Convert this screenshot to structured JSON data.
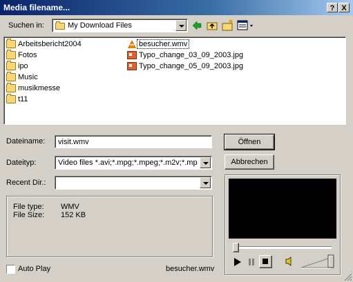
{
  "window": {
    "title": "Media filename...",
    "help_label": "?",
    "close_label": "X"
  },
  "lookin": {
    "label": "Suchen in:",
    "value": "My Download Files"
  },
  "files": {
    "folders": [
      "Arbeitsbericht2004",
      "Fotos",
      "ipo",
      "Music",
      "musikmesse",
      "t11"
    ],
    "media": [
      {
        "name": "besucher.wmv",
        "icon": "vlc-cone-icon",
        "selected": true
      },
      {
        "name": "Typo_change_03_09_2003.jpg",
        "icon": "jpg-image-icon"
      },
      {
        "name": "Typo_change_05_09_2003.jpg",
        "icon": "jpg-image-icon"
      }
    ]
  },
  "form": {
    "filename_label": "Dateiname:",
    "filename_value": "visit.wmv",
    "filetype_label": "Dateityp:",
    "filetype_value": "Video files *.avi;*.mpg;*.mpeg;*.m2v;*.mp2;*.q",
    "recent_label": "Recent Dir.:",
    "recent_value": ""
  },
  "buttons": {
    "open": "Öffnen",
    "cancel": "Abbrechen"
  },
  "info": {
    "type_label": "File type:",
    "type_value": "WMV",
    "size_label": "File Size:",
    "size_value": "152 KB"
  },
  "autoplay": {
    "label": "Auto Play",
    "checked": false
  },
  "current_file": "besucher.wmv",
  "colors": {
    "title_start": "#0a246a",
    "title_end": "#a6caf0",
    "selection": "#0a246a"
  }
}
